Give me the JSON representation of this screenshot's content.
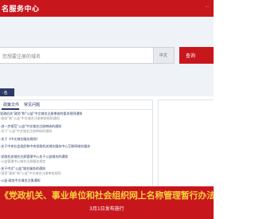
{
  "header": {
    "title": "名服务中心",
    "right_link": "···"
  },
  "search": {
    "placeholder": "您想要注册的域名",
    "suffix": "中文",
    "button": "查询",
    "tab": "·名"
  },
  "panel": {
    "tabs": [
      "政策文件",
      "常见问题"
    ],
    "items": [
      {
        "title": "党政机关\"政务\"和\"公益\"中文域名注册审核的要求规则通知",
        "sub": "·政务\"和\"公益\"中文域名注册审核规则通知"
      },
      {
        "title": "·进一步规范\"公益\"中文域名注册审核的通知",
        "sub": "·关于\"公益\"中文域名注册审核的通知"
      },
      {
        "title": "·关于《中文域名服务规则》",
        "sub": ""
      },
      {
        "title": "·关于中央社会组织和中央党政机关域名服务中心互联网域名服务",
        "sub": ""
      },
      {
        "title": "·党政机关域名注册管理中心关于公益域名的通知",
        "sub": "·公益管理中心域名注册服务规定"
      },
      {
        "title": "·关于中文\"公益\"域名服务的通知",
        "sub": "·国家\"政务\"和\"公益\"中文域名注册审核规则"
      },
      {
        "title": "·公益·政务中文域名注册通知",
        "sub": ""
      }
    ]
  },
  "banner": {
    "headline": "《党政机关、事业单位和社会组织网上名称管理暂行办法》",
    "subline": "3月1日发布施行"
  },
  "colors": {
    "brand_red": "#c8161d",
    "navy": "#2b3a66",
    "banner_text": "#f7d33b"
  }
}
